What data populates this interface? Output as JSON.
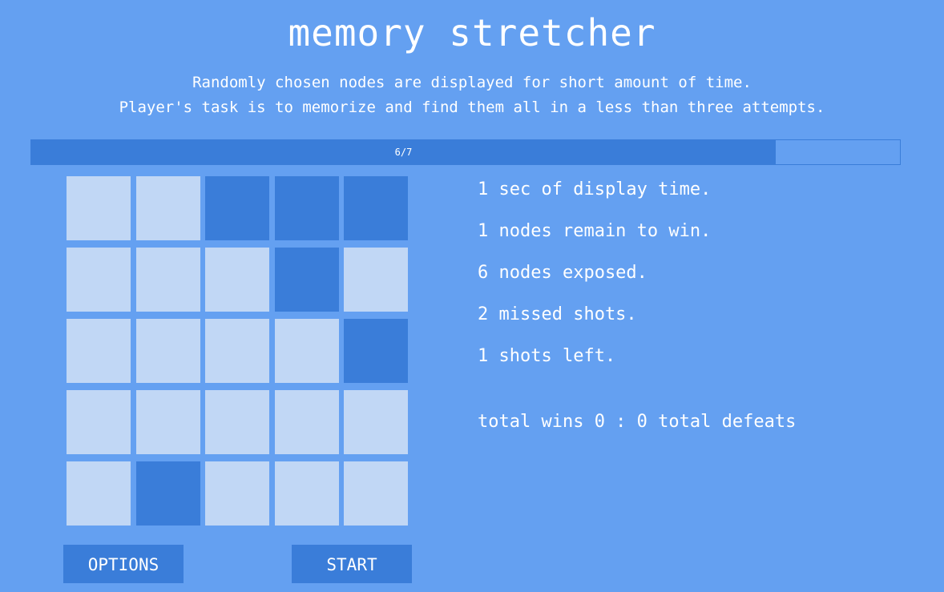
{
  "title": "memory stretcher",
  "description": {
    "line1": "Randomly chosen nodes are displayed for short amount of time.",
    "line2": "Player's task is to memorize and find them all in a less than three attempts."
  },
  "progress": {
    "label": "6/7",
    "current": 6,
    "total": 7
  },
  "grid": {
    "rows": 5,
    "cols": 5,
    "cells": [
      [
        0,
        0,
        1,
        1,
        1
      ],
      [
        0,
        0,
        0,
        1,
        0
      ],
      [
        0,
        0,
        0,
        0,
        1
      ],
      [
        0,
        0,
        0,
        0,
        0
      ],
      [
        0,
        1,
        0,
        0,
        0
      ]
    ]
  },
  "stats": {
    "display_time": "1 sec of display time.",
    "remaining": "1 nodes remain to win.",
    "exposed": "6 nodes exposed.",
    "missed": "2 missed shots.",
    "shots_left": "1 shots left."
  },
  "score": {
    "text": "total wins 0 : 0 total defeats"
  },
  "buttons": {
    "options": "OPTIONS",
    "start": "START"
  },
  "colors": {
    "background": "#64a0f1",
    "accent": "#3a7dd9",
    "cell_idle": "#c1d7f5"
  }
}
